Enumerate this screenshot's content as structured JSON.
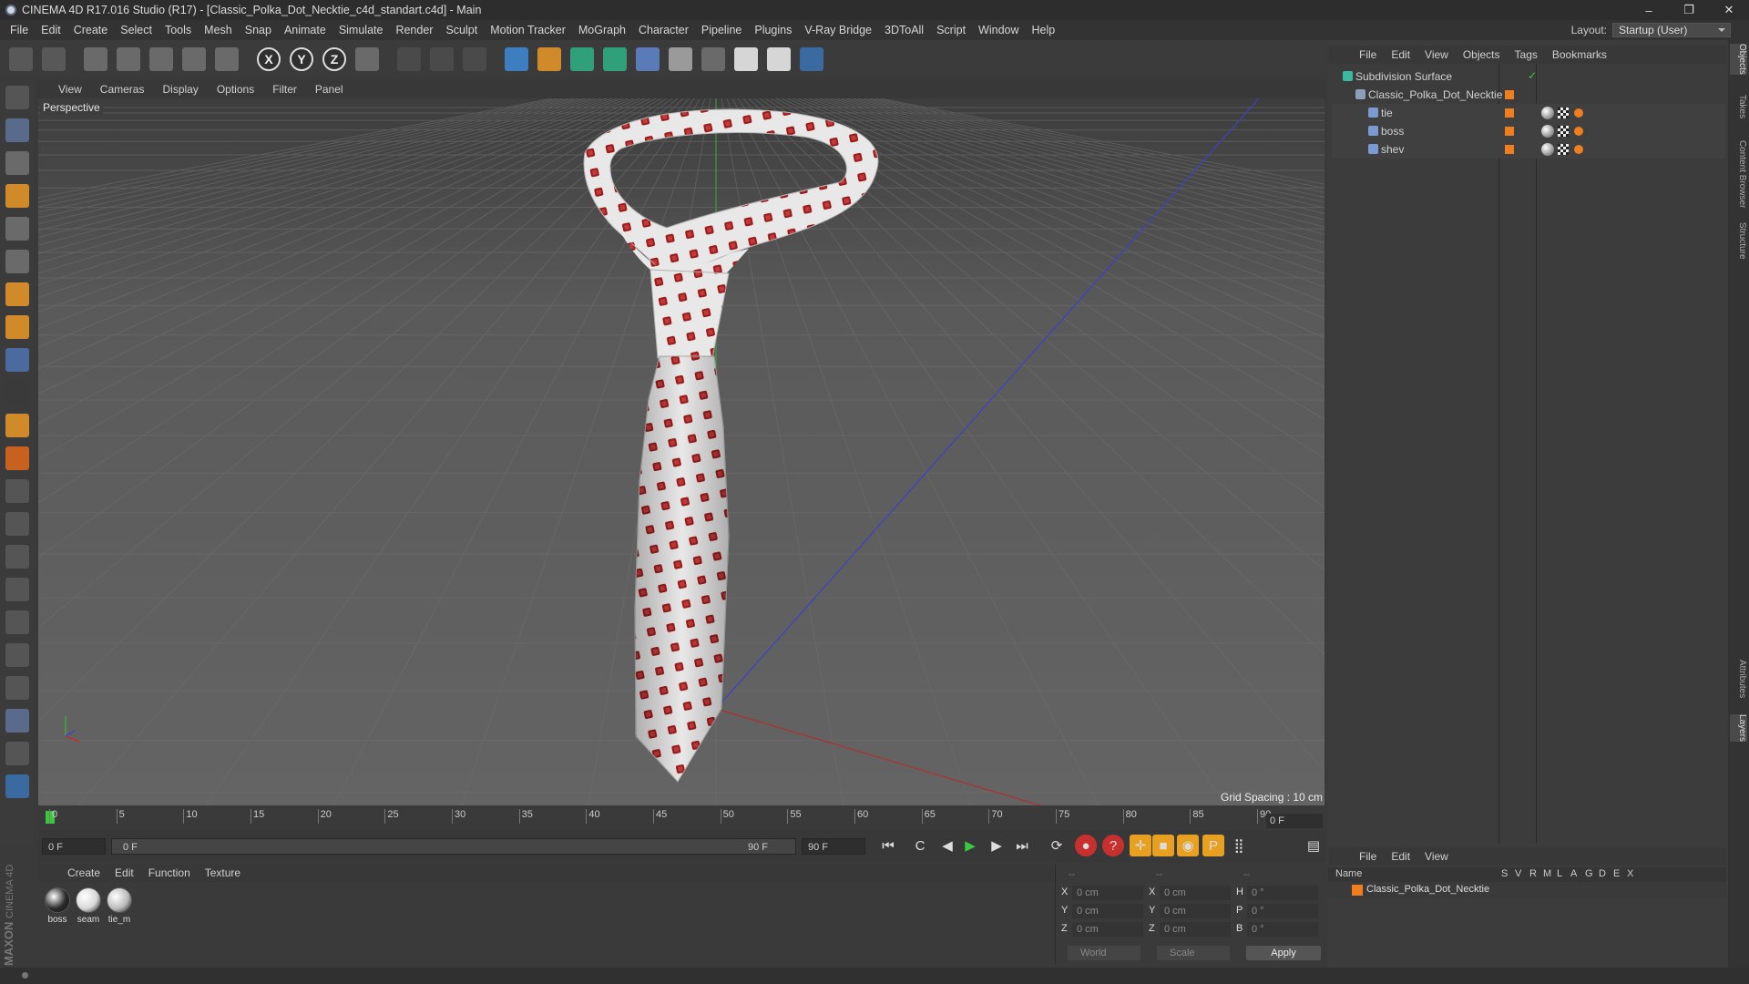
{
  "window": {
    "title": "CINEMA 4D R17.016 Studio (R17) - [Classic_Polka_Dot_Necktie_c4d_standart.c4d] - Main",
    "controls": [
      "–",
      "❐",
      "✕"
    ]
  },
  "menubar": {
    "items": [
      "File",
      "Edit",
      "Create",
      "Select",
      "Tools",
      "Mesh",
      "Snap",
      "Animate",
      "Simulate",
      "Render",
      "Sculpt",
      "Motion Tracker",
      "MoGraph",
      "Character",
      "Pipeline",
      "Plugins",
      "V-Ray Bridge",
      "3DToAll",
      "Script",
      "Window",
      "Help"
    ],
    "layout_label": "Layout:",
    "layout_value": "Startup (User)"
  },
  "toolbar": {
    "icons": [
      "undo-icon",
      "redo-icon",
      "live-selection-icon",
      "move-icon",
      "scale-icon",
      "rotate-icon",
      "move-axis-icon",
      "x-axis-icon",
      "y-axis-icon",
      "z-axis-icon",
      "world-coord-icon",
      "render-view-icon",
      "render-picture-viewer-icon",
      "edit-render-settings-icon",
      "cube-icon",
      "pen-icon",
      "subdivision-icon",
      "cloner-icon",
      "deformer-icon",
      "floor-icon",
      "camera-icon",
      "light-icon",
      "xpresso-icon",
      "python-icon"
    ],
    "axis_labels": [
      "X",
      "Y",
      "Z"
    ]
  },
  "viewport": {
    "menu": [
      "View",
      "Cameras",
      "Display",
      "Options",
      "Filter",
      "Panel"
    ],
    "label": "Perspective",
    "grid_spacing": "Grid Spacing : 10 cm"
  },
  "timeline": {
    "ticks": [
      "0",
      "5",
      "10",
      "15",
      "20",
      "25",
      "30",
      "35",
      "40",
      "45",
      "50",
      "55",
      "60",
      "65",
      "70",
      "75",
      "80",
      "85",
      "90"
    ],
    "current_frame": "0 F",
    "start_field": "0 F",
    "range_start": "0 F",
    "range_end": "90 F",
    "end_field": "90 F"
  },
  "materials": {
    "menu": [
      "Create",
      "Edit",
      "Function",
      "Texture"
    ],
    "items": [
      {
        "label": "boss",
        "color": "#2b2b2b"
      },
      {
        "label": "seam",
        "color": "#d8d8d8"
      },
      {
        "label": "tie_m",
        "color": "#bcbcbc"
      }
    ]
  },
  "coordinates": {
    "header_a": "--",
    "header_b": "--",
    "header_c": "--",
    "rows": [
      {
        "a": "X",
        "av": "0 cm",
        "b": "X",
        "bv": "0 cm",
        "c": "H",
        "cv": "0 °"
      },
      {
        "a": "Y",
        "av": "0 cm",
        "b": "Y",
        "bv": "0 cm",
        "c": "P",
        "cv": "0 °"
      },
      {
        "a": "Z",
        "av": "0 cm",
        "b": "Z",
        "bv": "0 cm",
        "c": "B",
        "cv": "0 °"
      }
    ],
    "mode": "World",
    "transform": "Scale",
    "apply": "Apply"
  },
  "objects": {
    "menu": [
      "File",
      "Edit",
      "View",
      "Objects",
      "Tags",
      "Bookmarks"
    ],
    "tree": [
      {
        "name": "Subdivision Surface"
      },
      {
        "name": "Classic_Polka_Dot_Necktie"
      },
      {
        "name": "tie"
      },
      {
        "name": "boss"
      },
      {
        "name": "shev"
      }
    ]
  },
  "layers": {
    "menu": [
      "File",
      "Edit",
      "View"
    ],
    "columns": [
      "Name",
      "S",
      "V",
      "R",
      "M",
      "L",
      "A",
      "G",
      "D",
      "E",
      "X"
    ],
    "row_name": "Classic_Polka_Dot_Necktie"
  },
  "side_tabs": [
    "Objects",
    "Takes",
    "Content Browser",
    "Structure",
    "Attributes",
    "Layers"
  ],
  "brand": {
    "text1": "MAXON",
    "text2": "CINEMA 4D"
  },
  "colors": {
    "accent": "#f07d1e",
    "tie_dot": "#9b1a1a",
    "tie_base": "#e6e6e6"
  }
}
